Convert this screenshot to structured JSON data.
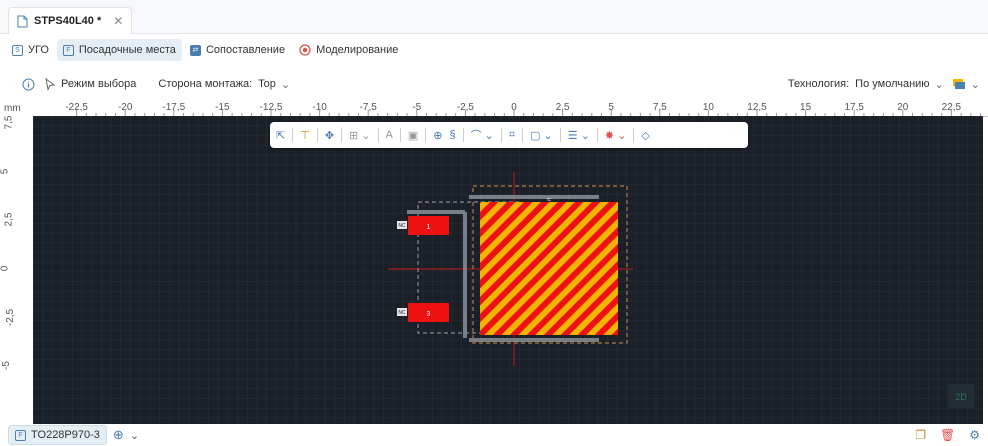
{
  "document_tab": {
    "title": "STPS40L40 *",
    "close_icon": "close-icon"
  },
  "mode_tabs": [
    {
      "label": "УГО",
      "icon": "symbol-icon",
      "active": false
    },
    {
      "label": "Посадочные места",
      "icon": "footprint-icon",
      "active": true
    },
    {
      "label": "Сопоставление",
      "icon": "mapping-icon",
      "active": false
    },
    {
      "label": "Моделирование",
      "icon": "modeling-icon",
      "active": false
    }
  ],
  "toolbar": {
    "info_icon": "info-icon",
    "select_mode_label": "Режим выбора",
    "mount_side_label": "Сторона монтажа:",
    "mount_side_value": "Top",
    "technology_label": "Технология:",
    "technology_value": "По умолчанию"
  },
  "ruler": {
    "unit": "mm",
    "x_ticks": [
      "-22,5",
      "-20",
      "-17,5",
      "-15",
      "-12,5",
      "-10",
      "-7,5",
      "-5",
      "-2,5",
      "0",
      "2,5",
      "5",
      "7,5",
      "10",
      "12,5",
      "15",
      "17,5",
      "20",
      "22,5"
    ],
    "y_ticks": [
      "7,5",
      "5",
      "2,5",
      "0",
      "-2,5",
      "-5"
    ]
  },
  "pads": [
    {
      "number": "1",
      "tag": "NC"
    },
    {
      "number": "3",
      "tag": "NC"
    }
  ],
  "canvas_labels": {
    "view_badge": "2D",
    "top_marker": "≈"
  },
  "footer": {
    "variant_label": "TO228P970-3"
  },
  "colors": {
    "canvas_bg": "#1b2028",
    "pad_red": "#ee1111",
    "thermal_yellow": "#f4b400",
    "accent": "#4a7bb0"
  }
}
